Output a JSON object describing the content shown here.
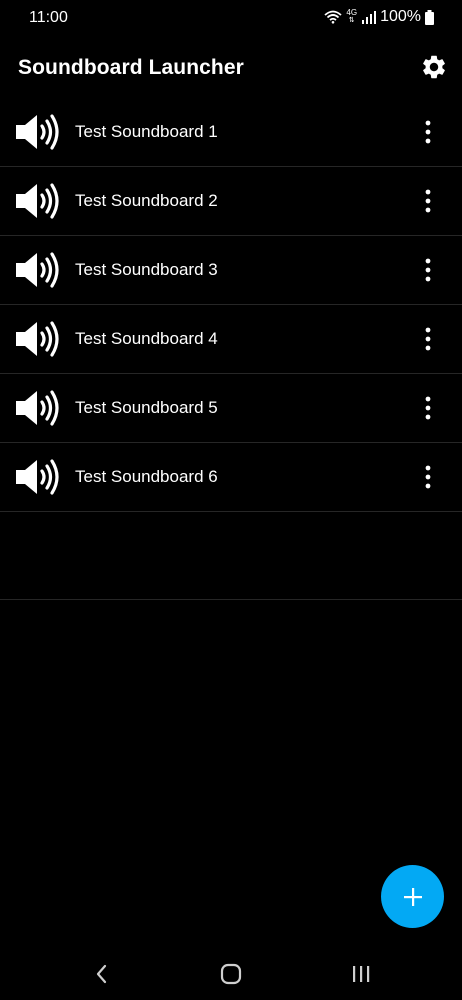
{
  "status_bar": {
    "time": "11:00",
    "network": "4G",
    "battery_percent": "100%",
    "icons": [
      "wifi-icon",
      "network-4g-icon",
      "signal-icon",
      "battery-icon"
    ]
  },
  "app_bar": {
    "title": "Soundboard Launcher",
    "settings_icon": "gear-icon"
  },
  "soundboards": [
    {
      "label": "Test Soundboard 1",
      "icon": "speaker-icon"
    },
    {
      "label": "Test Soundboard 2",
      "icon": "speaker-icon"
    },
    {
      "label": "Test Soundboard 3",
      "icon": "speaker-icon"
    },
    {
      "label": "Test Soundboard 4",
      "icon": "speaker-icon"
    },
    {
      "label": "Test Soundboard 5",
      "icon": "speaker-icon"
    },
    {
      "label": "Test Soundboard 6",
      "icon": "speaker-icon"
    }
  ],
  "fab": {
    "icon": "plus-icon"
  },
  "colors": {
    "background": "#000000",
    "accent": "#03A9F4",
    "text": "#ffffff",
    "divider": "#262626"
  },
  "nav_bar": {
    "icons": [
      "back-icon",
      "home-icon",
      "recents-icon"
    ]
  }
}
